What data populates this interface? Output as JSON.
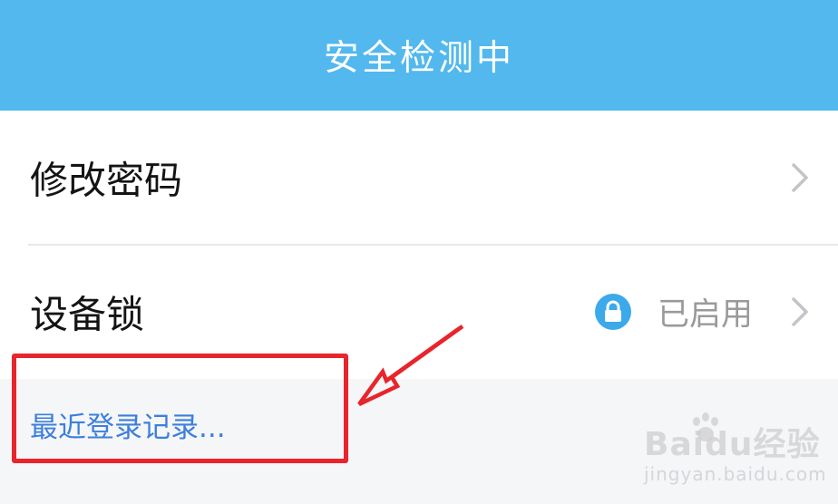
{
  "header": {
    "title": "安全检测中"
  },
  "settings": {
    "items": [
      {
        "label": "修改密码"
      },
      {
        "label": "设备锁",
        "status": "已启用",
        "status_icon": "lock-icon"
      }
    ]
  },
  "recent_login": {
    "label": "最近登录记录..."
  },
  "watermark": {
    "brand": "Baidu经验",
    "url": "jingyan.baidu.com"
  },
  "colors": {
    "header_bg": "#52b8ee",
    "link": "#3d7fdc",
    "annotation": "#e8242c",
    "lock_badge": "#3ba9ea"
  }
}
